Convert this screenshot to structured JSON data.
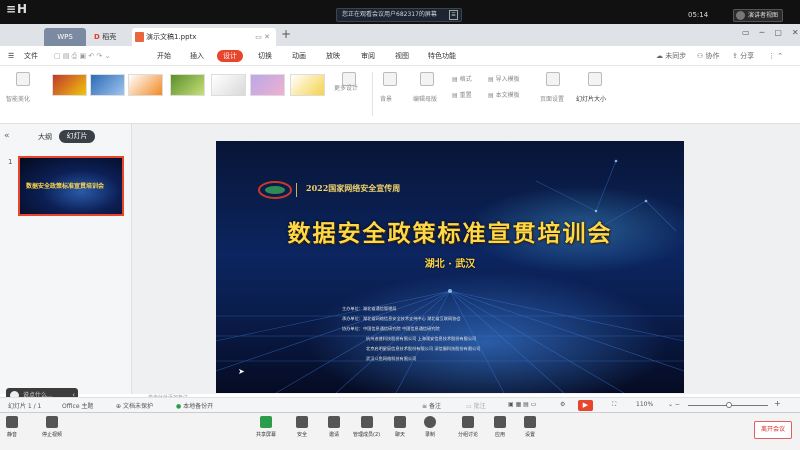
{
  "meeting": {
    "logo": "≡H",
    "share_notice": "您正在观看会议用户682317的屏幕",
    "time": "05:14",
    "speaker": "演讲者视图",
    "bottom_left": [
      {
        "label": "静音",
        "icon": "microphone-icon"
      },
      {
        "label": "停止视频",
        "icon": "video-camera-icon"
      }
    ],
    "bottom_center": [
      {
        "label": "共享屏幕",
        "icon": "share-screen-icon"
      },
      {
        "label": "安全",
        "icon": "shield-icon"
      },
      {
        "label": "邀请",
        "icon": "invite-icon"
      },
      {
        "label": "管理成员(2)",
        "icon": "members-icon"
      },
      {
        "label": "聊天",
        "icon": "chat-icon"
      },
      {
        "label": "录制",
        "icon": "record-icon"
      },
      {
        "label": "分组讨论",
        "icon": "breakout-icon"
      },
      {
        "label": "应用",
        "icon": "apps-icon"
      },
      {
        "label": "设置",
        "icon": "settings-icon"
      }
    ],
    "leave": "离开会议",
    "chat_placeholder": "说点什么..."
  },
  "wps": {
    "tabs": {
      "wps": "WPS",
      "templates": "稻壳",
      "document": "演示文稿1.pptx"
    },
    "menu": {
      "file": "文件",
      "items": [
        "开始",
        "插入",
        "设计",
        "切换",
        "动画",
        "放映",
        "审阅",
        "视图",
        "特色功能"
      ],
      "active": "设计",
      "right": [
        "未同步",
        "协作",
        "分享"
      ]
    },
    "ribbon": {
      "smart_beautify": "智能美化",
      "more_design": "更多设计",
      "background": "背景",
      "edit_master": "编辑母版",
      "format": "格式",
      "reset": "重置",
      "import_template": "导入模板",
      "text_template": "本文模板",
      "page_setup": "页面设置",
      "slide_size": "幻灯片大小"
    },
    "panel": {
      "outline": "大纲",
      "slides": "幻灯片",
      "slide_number": "1"
    },
    "notes_placeholder": "单击此处添加备注",
    "status": {
      "slide_count": "幻灯片 1 / 1",
      "theme": "Office 主题",
      "protection": "文档未保护",
      "backup": "本地备份开",
      "notes": "备注",
      "annotate": "批注",
      "zoom": "110%"
    }
  },
  "slide": {
    "event": "2022国家网络安全宣传周",
    "title": "数据安全政策标准宣贯培训会",
    "subtitle": "湖北 · 武汉",
    "orgs": [
      "主办单位：湖北省通信管理局",
      "承办单位：湖北省网络信息安全技术支持中心 湖北省互联网协会",
      "协办单位：中国信息通信研究院 中国信息通信研究院",
      "杭州迪普科技股份有限公司 上海观安信息技术股份有限公司",
      "北京启明星辰信息技术股份有限公司 深信服科技股份有限公司",
      "武汉斗鱼网络科技有限公司"
    ]
  }
}
